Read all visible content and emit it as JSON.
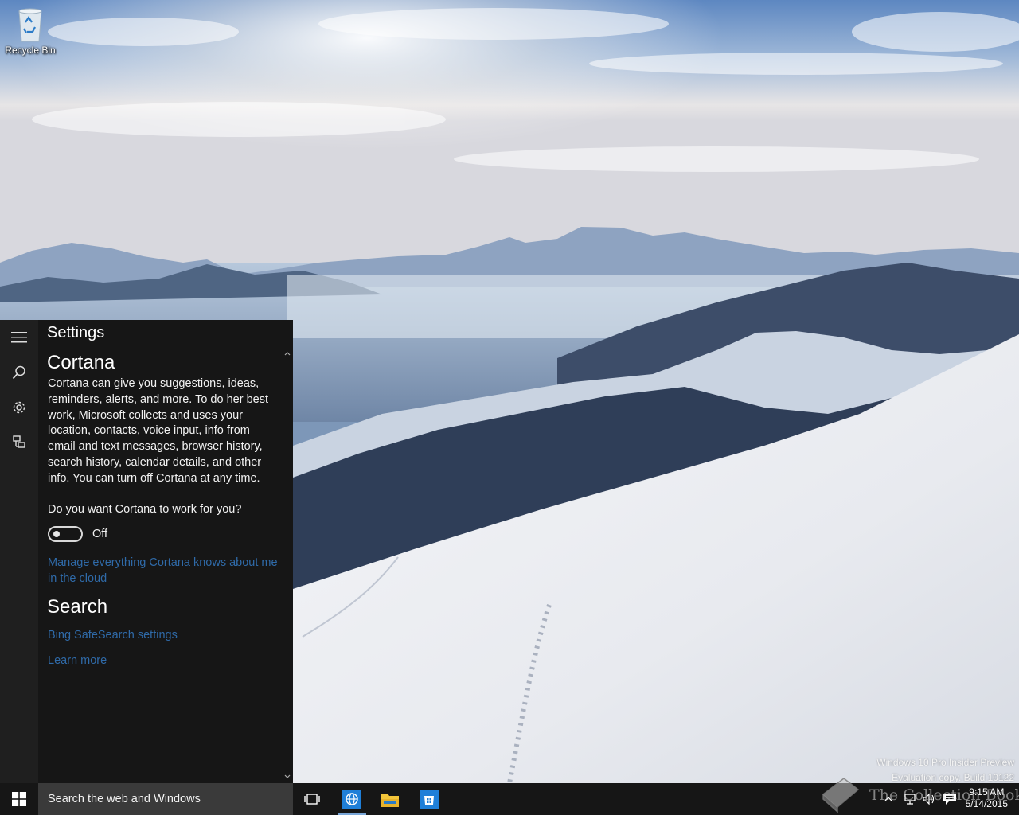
{
  "desktop": {
    "icons": [
      {
        "label": "Recycle Bin",
        "icon": "recycle-bin-icon"
      }
    ],
    "evaluation": {
      "line1": "Windows 10 Pro Insider Preview",
      "line2": "Evaluation copy. Build 10122"
    },
    "watermark": "The Collection Book"
  },
  "cortana": {
    "rail": [
      "hamburger-menu-icon",
      "search-icon",
      "settings-gear-icon",
      "feedback-icon"
    ],
    "settings_title": "Settings",
    "cortana_heading": "Cortana",
    "description": "Cortana can give you suggestions, ideas, reminders, alerts, and more. To do her best work, Microsoft collects and uses your location, contacts, voice input, info from email and text messages, browser history, search history, calendar details, and other info. You can turn off Cortana at any time.",
    "question": "Do you want Cortana to work for you?",
    "toggle_state": "Off",
    "toggle_on": false,
    "manage_link": "Manage everything Cortana knows about me in the cloud",
    "search_heading": "Search",
    "bing_link": "Bing SafeSearch settings",
    "learn_link": "Learn more"
  },
  "taskbar": {
    "search_placeholder": "Search the web and Windows",
    "apps": [
      "task-view-icon",
      "internet-explorer-icon",
      "file-explorer-icon",
      "store-icon"
    ],
    "tray": [
      "show-hidden-icons-icon",
      "network-icon",
      "volume-icon",
      "action-center-icon"
    ],
    "time": "9:15 AM",
    "date": "5/14/2015"
  },
  "colors": {
    "panel_bg": "#161616",
    "rail_bg": "#1f1f1f",
    "link": "#2f6aa8",
    "taskbar_bg": "#161616",
    "search_bg": "#3a3a3a"
  }
}
